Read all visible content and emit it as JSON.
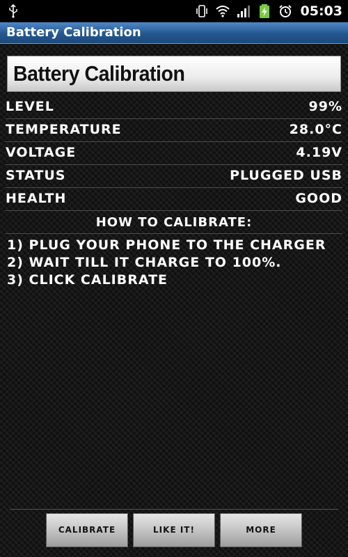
{
  "status_bar": {
    "time": "05:03",
    "icons": [
      "usb-icon",
      "vibrate-icon",
      "wifi-icon",
      "signal-icon",
      "battery-charging-icon",
      "alarm-icon"
    ]
  },
  "app": {
    "title": "Battery Calibration"
  },
  "header": {
    "text": "Battery Calibration"
  },
  "info": {
    "level": {
      "label": "LEVEL",
      "value": "99%"
    },
    "temperature": {
      "label": "TEMPERATURE",
      "value": "28.0°C"
    },
    "voltage": {
      "label": "VOLTAGE",
      "value": "4.19V"
    },
    "status": {
      "label": "STATUS",
      "value": "PLUGGED USB"
    },
    "health": {
      "label": "HEALTH",
      "value": "GOOD"
    }
  },
  "instructions": {
    "heading": "HOW TO CALIBRATE:",
    "steps": [
      "1) PLUG YOUR PHONE TO THE CHARGER",
      "2) WAIT TILL IT CHARGE TO 100%.",
      "3) CLICK CALIBRATE"
    ]
  },
  "buttons": {
    "calibrate": "CALIBRATE",
    "like": "LIKE IT!",
    "more": "MORE"
  },
  "colors": {
    "title_bar": "#24578f",
    "background": "#161616",
    "text": "#ffffff",
    "battery_charging": "#7ac943"
  }
}
